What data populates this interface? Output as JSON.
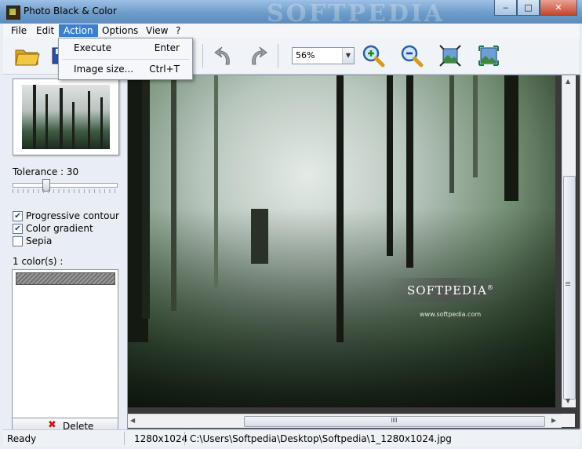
{
  "window": {
    "title": "Photo Black & Color",
    "watermark": "SOFTPEDIA"
  },
  "menubar": {
    "items": [
      "File",
      "Edit",
      "Action",
      "Options",
      "View",
      "?"
    ],
    "active": "Action"
  },
  "dropdown": {
    "items": [
      {
        "label": "Execute",
        "shortcut": "Enter"
      },
      {
        "label": "Image size...",
        "shortcut": "Ctrl+T"
      }
    ]
  },
  "toolbar": {
    "zoom_value": "56%"
  },
  "left_panel": {
    "tolerance_label": "Tolerance : 30",
    "tolerance_level": 30,
    "checkboxes": [
      {
        "label": "Progressive contour",
        "checked": true
      },
      {
        "label": "Color gradient",
        "checked": true
      },
      {
        "label": "Sepia",
        "checked": false
      }
    ],
    "colors_label": "1 color(s) :",
    "delete_label": "Delete"
  },
  "photo": {
    "logo_text": "SOFTPEDIA",
    "logo_mark": "®",
    "url_text": "www.softpedia.com"
  },
  "statusbar": {
    "status": "Ready",
    "dimensions": "1280x1024",
    "path": "C:\\Users\\Softpedia\\Desktop\\Softpedia\\1_1280x1024.jpg"
  },
  "colors": {
    "titlebar": "#6f9cc9",
    "menu_active": "#3b7fd1",
    "delete_x": "#d01010"
  }
}
